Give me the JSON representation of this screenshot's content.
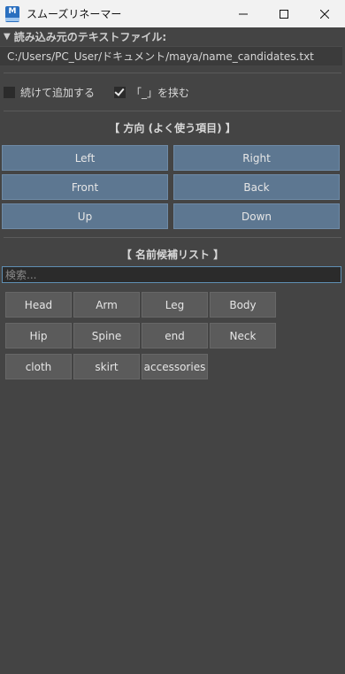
{
  "window": {
    "title": "スムーズリネーマー",
    "app_icon_letter": "M",
    "minimize_icon": "minimize-icon",
    "maximize_icon": "maximize-icon",
    "close_icon": "close-icon"
  },
  "source_file": {
    "header": "読み込み元のテキストファイル:",
    "path": "C:/Users/PC_User/ドキュメント/maya/name_candidates.txt"
  },
  "options": {
    "append_label": "続けて追加する",
    "append_checked": false,
    "wrap_label": "「_」を挟む",
    "wrap_checked": true
  },
  "directions": {
    "title": "【 方向 (よく使う項目) 】",
    "buttons": [
      "Left",
      "Right",
      "Front",
      "Back",
      "Up",
      "Down"
    ]
  },
  "candidates": {
    "title": "【 名前候補リスト 】",
    "search_placeholder": "検索...",
    "items": [
      "Head",
      "Arm",
      "Leg",
      "Body",
      "Hip",
      "Spine",
      "end",
      "Neck",
      "cloth",
      "skirt",
      "accessories"
    ]
  },
  "colors": {
    "background": "#444444",
    "direction_button": "#5d7791",
    "candidate_button": "#5b5b5b",
    "search_focus_border": "#5f8fb3"
  }
}
